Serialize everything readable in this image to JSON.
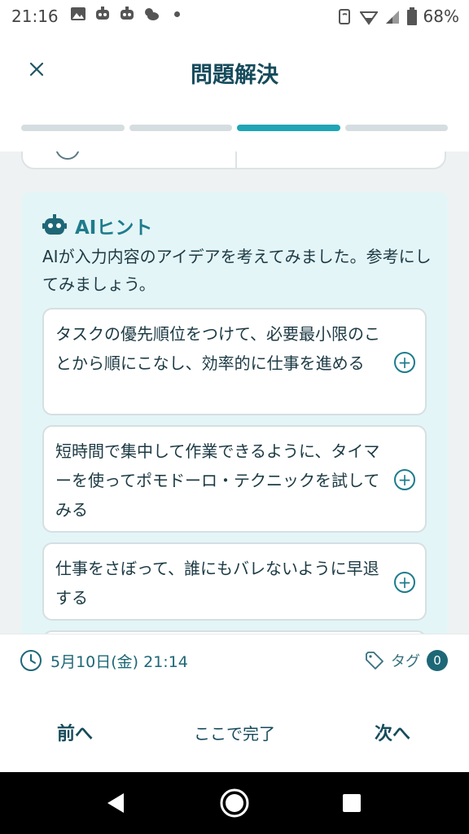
{
  "status_bar": {
    "time": "21:16",
    "battery": "68%"
  },
  "header": {
    "title": "問題解決",
    "progress": {
      "total_steps": 4,
      "current_step": 3
    }
  },
  "hint": {
    "title": "AIヒント",
    "description": "AIが入力内容のアイデアを考えてみました。参考にしてみましょう。",
    "suggestions": [
      {
        "text": "タスクの優先順位をつけて、必要最小限のことから順にこなし、効率的に仕事を進める"
      },
      {
        "text": "短時間で集中して作業できるように、タイマーを使ってポモドーロ・テクニックを試してみる"
      },
      {
        "text": "仕事をさぼって、誰にもバレないように早退する"
      }
    ]
  },
  "info": {
    "datetime": "5月10日(金) 21:14",
    "tag_label": "タグ",
    "tag_count": "0"
  },
  "actions": {
    "prev": "前へ",
    "done": "ここで完了",
    "next": "次へ"
  },
  "colors": {
    "accent": "#1fa5b5",
    "primary_text": "#164b5c",
    "hint_bg": "#e4f5f7"
  }
}
